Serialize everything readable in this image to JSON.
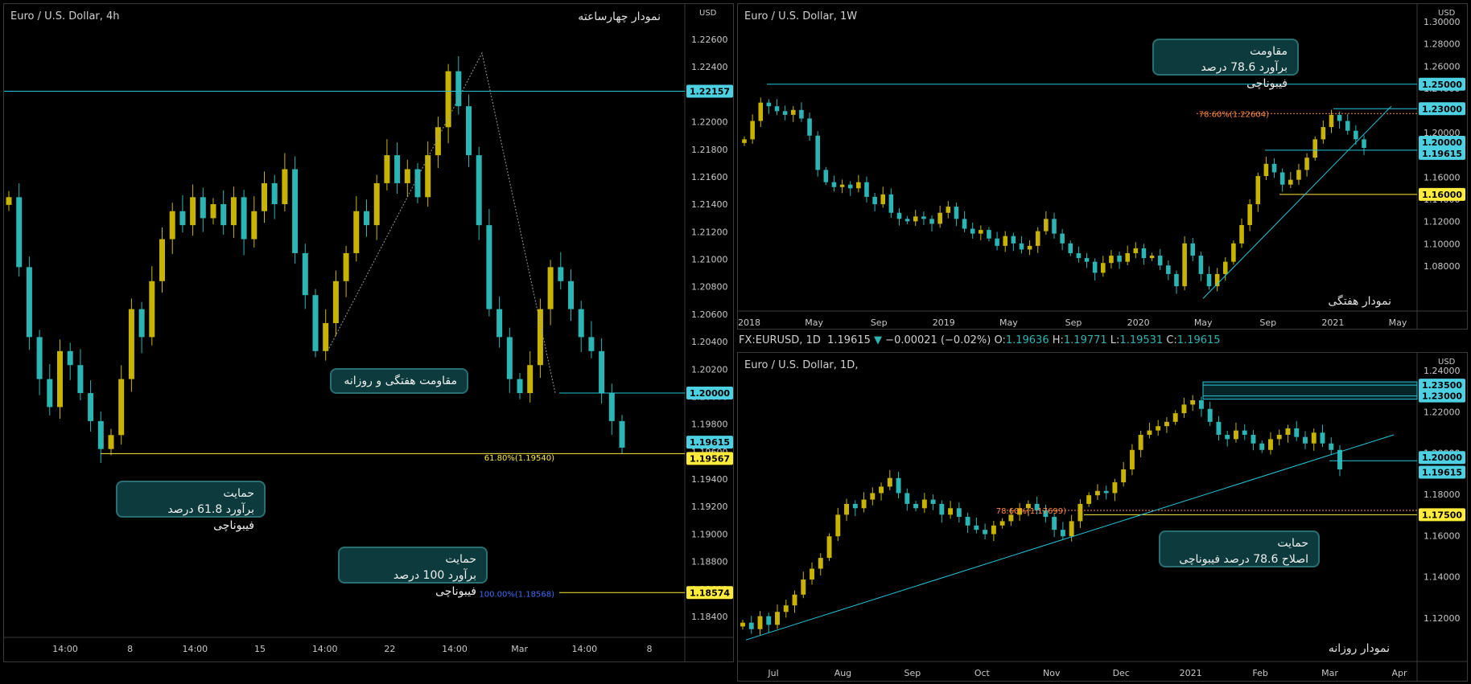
{
  "panels": {
    "left": {
      "title": "Euro / U.S. Dollar, 4h",
      "fa_title": "نمودار چهارساعته",
      "currency": "USD",
      "price_labels": [
        "1.22600",
        "1.22400",
        "1.22200",
        "1.22000",
        "1.21800",
        "1.21600",
        "1.21400",
        "1.21200",
        "1.21000",
        "1.20800",
        "1.20600",
        "1.20400",
        "1.20200",
        "1.20000",
        "1.19800",
        "1.19600",
        "1.19400",
        "1.19200",
        "1.19000",
        "1.18800",
        "1.18600",
        "1.18400"
      ],
      "time_labels": [
        "14:00",
        "8",
        "14:00",
        "15",
        "14:00",
        "22",
        "14:00",
        "Mar",
        "14:00",
        "8"
      ],
      "tags": [
        {
          "text": "1.22157",
          "color": "#4dd0e1"
        },
        {
          "text": "1.20000",
          "color": "#4dd0e1"
        },
        {
          "text": "1.19615",
          "color": "#4dd0e1"
        },
        {
          "text": "1.19567",
          "color": "#ffeb3b"
        },
        {
          "text": "1.18574",
          "color": "#ffeb3b"
        }
      ],
      "fib_labels": [
        "61.80%(1.19540)",
        "100.00%(1.18568)"
      ],
      "callouts": [
        {
          "lines": [
            "مقاومت هفتگی و روزانه"
          ]
        },
        {
          "lines": [
            "حمایت",
            "برآورد 61.8 درصد فیبوناچی"
          ]
        },
        {
          "lines": [
            "حمایت",
            "برآورد 100 درصد فیبوناچی"
          ]
        }
      ]
    },
    "weekly": {
      "title": "Euro / U.S. Dollar, 1W",
      "fa_title": "نمودار هفتگی",
      "currency": "USD",
      "price_labels": [
        "1.30000",
        "1.28000",
        "1.26000",
        "1.24000",
        "1.22000",
        "1.20000",
        "1.18000",
        "1.16000",
        "1.14000",
        "1.12000",
        "1.10000",
        "1.08000"
      ],
      "time_labels": [
        "2018",
        "May",
        "Sep",
        "2019",
        "May",
        "Sep",
        "2020",
        "May",
        "Sep",
        "2021",
        "May"
      ],
      "tags": [
        {
          "text": "1.25000",
          "color": "#4dd0e1"
        },
        {
          "text": "1.23000",
          "color": "#4dd0e1"
        },
        {
          "text": "1.20000",
          "color": "#4dd0e1"
        },
        {
          "text": "1.19615",
          "color": "#4dd0e1"
        },
        {
          "text": "1.16000",
          "color": "#ffeb3b"
        }
      ],
      "fib_labels": [
        "78.60%(1.22604)"
      ],
      "callouts": [
        {
          "lines": [
            "مقاومت",
            "برآورد 78.6 درصد فیبوناچی"
          ]
        }
      ]
    },
    "daily": {
      "title": "Euro / U.S. Dollar, 1D,",
      "fa_title": "نمودار روزانه",
      "currency": "USD",
      "price_labels": [
        "1.24000",
        "1.22000",
        "1.20000",
        "1.18000",
        "1.16000",
        "1.14000",
        "1.12000"
      ],
      "time_labels": [
        "Jul",
        "Aug",
        "Sep",
        "Oct",
        "Nov",
        "Dec",
        "2021",
        "Feb",
        "Mar",
        "Apr"
      ],
      "tags": [
        {
          "text": "1.23500",
          "color": "#4dd0e1"
        },
        {
          "text": "1.23000",
          "color": "#4dd0e1"
        },
        {
          "text": "1.20000",
          "color": "#4dd0e1"
        },
        {
          "text": "1.19615",
          "color": "#4dd0e1"
        },
        {
          "text": "1.17500",
          "color": "#ffeb3b"
        }
      ],
      "fib_labels": [
        "78.60%(1.17699)"
      ],
      "callouts": [
        {
          "lines": [
            "حمایت",
            "اصلاح 78.6 درصد فیبوناچی"
          ]
        }
      ]
    }
  },
  "infobar": {
    "symbol": "FX:EURUSD, 1D",
    "last": "1.19615",
    "arrow": "▼",
    "change": "−0.00021 (−0.02%)",
    "o_label": "O:",
    "o": "1.19636",
    "h_label": "H:",
    "h": "1.19771",
    "l_label": "L:",
    "l": "1.19531",
    "c_label": "C:",
    "c": "1.19615"
  },
  "colors": {
    "up": "#c8b400",
    "down": "#2bb5b5",
    "line": "#26c6da",
    "yellow": "#ffeb3b",
    "fib_orange": "#ff8a3d",
    "fib_blue": "#3f6df5"
  },
  "chart_data": [
    {
      "type": "candlestick",
      "title": "Euro / U.S. Dollar, 4h",
      "ylim": [
        1.183,
        1.227
      ],
      "hlines": [
        1.22157,
        1.2,
        1.19567,
        1.18574
      ],
      "closes": [
        1.214,
        1.209,
        1.204,
        1.201,
        1.199,
        1.203,
        1.202,
        1.2,
        1.198,
        1.196,
        1.197,
        1.201,
        1.206,
        1.204,
        1.208,
        1.211,
        1.213,
        1.212,
        1.214,
        1.2125,
        1.2135,
        1.212,
        1.214,
        1.211,
        1.213,
        1.215,
        1.2135,
        1.216,
        1.21,
        1.207,
        1.203,
        1.205,
        1.208,
        1.21,
        1.213,
        1.212,
        1.215,
        1.217,
        1.215,
        1.216,
        1.214,
        1.217,
        1.219,
        1.223,
        1.2205,
        1.217,
        1.212,
        1.206,
        1.204,
        1.201,
        1.2,
        1.202,
        1.206,
        1.209,
        1.208,
        1.206,
        1.204,
        1.203,
        1.2,
        1.198,
        1.1961
      ]
    },
    {
      "type": "candlestick",
      "title": "Euro / U.S. Dollar, 1W",
      "ylim": [
        1.07,
        1.305
      ],
      "hlines": [
        1.25,
        1.23,
        1.2,
        1.19615,
        1.16
      ],
      "closes": [
        1.205,
        1.22,
        1.235,
        1.232,
        1.228,
        1.225,
        1.229,
        1.222,
        1.208,
        1.18,
        1.17,
        1.166,
        1.168,
        1.165,
        1.17,
        1.158,
        1.152,
        1.16,
        1.145,
        1.14,
        1.138,
        1.142,
        1.14,
        1.136,
        1.145,
        1.15,
        1.14,
        1.132,
        1.128,
        1.131,
        1.124,
        1.118,
        1.126,
        1.12,
        1.115,
        1.118,
        1.13,
        1.14,
        1.128,
        1.12,
        1.112,
        1.108,
        1.105,
        1.096,
        1.104,
        1.11,
        1.105,
        1.112,
        1.116,
        1.108,
        1.11,
        1.102,
        1.095,
        1.085,
        1.12,
        1.11,
        1.095,
        1.085,
        1.095,
        1.105,
        1.12,
        1.135,
        1.152,
        1.175,
        1.185,
        1.178,
        1.168,
        1.172,
        1.18,
        1.19,
        1.205,
        1.215,
        1.225,
        1.22,
        1.212,
        1.205,
        1.198
      ]
    },
    {
      "type": "candlestick",
      "title": "Euro / U.S. Dollar, 1D,",
      "ylim": [
        1.11,
        1.244
      ],
      "hlines": [
        1.235,
        1.23,
        1.2,
        1.19615,
        1.175
      ],
      "closes": [
        1.125,
        1.122,
        1.128,
        1.124,
        1.13,
        1.133,
        1.138,
        1.145,
        1.15,
        1.155,
        1.165,
        1.175,
        1.18,
        1.178,
        1.182,
        1.185,
        1.188,
        1.192,
        1.185,
        1.18,
        1.178,
        1.182,
        1.18,
        1.175,
        1.178,
        1.174,
        1.17,
        1.168,
        1.166,
        1.17,
        1.172,
        1.175,
        1.178,
        1.18,
        1.177,
        1.174,
        1.168,
        1.165,
        1.172,
        1.18,
        1.184,
        1.186,
        1.185,
        1.19,
        1.196,
        1.205,
        1.212,
        1.214,
        1.216,
        1.218,
        1.222,
        1.226,
        1.228,
        1.224,
        1.218,
        1.212,
        1.21,
        1.214,
        1.212,
        1.208,
        1.205,
        1.21,
        1.212,
        1.215,
        1.211,
        1.208,
        1.213,
        1.208,
        1.205,
        1.196
      ]
    }
  ]
}
